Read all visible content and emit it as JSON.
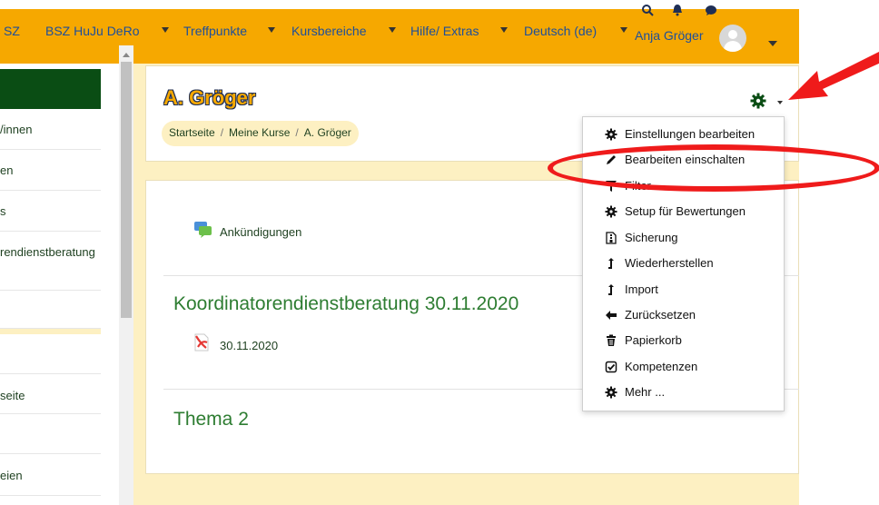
{
  "navbar": {
    "items": [
      {
        "label": "SZ",
        "caret": false
      },
      {
        "label": "BSZ HuJu DeRo",
        "caret": true
      },
      {
        "label": "Treffpunkte",
        "caret": true
      },
      {
        "label": "Kursbereiche",
        "caret": true
      },
      {
        "label": "Hilfe/ Extras",
        "caret": true
      },
      {
        "label": "Deutsch (de)",
        "caret": true
      }
    ],
    "icons": [
      "search-icon",
      "bell-icon",
      "chat-icon"
    ],
    "user_name": "Anja Gröger"
  },
  "drawer": {
    "items": [
      "/innen",
      "en",
      "s",
      "rendienstberatung",
      "",
      "",
      "seite",
      "",
      "eien"
    ]
  },
  "page": {
    "title": "A. Gröger",
    "breadcrumb": [
      "Startseite",
      "Meine Kurse",
      "A. Gröger"
    ]
  },
  "course": {
    "announcement": "Ankündigungen",
    "sections": [
      {
        "title": "Koordinatorendienstberatung 30.11.2020",
        "file": "30.11.2020"
      },
      {
        "title": "Thema 2"
      }
    ]
  },
  "menu": {
    "items": [
      {
        "label": "Einstellungen bearbeiten",
        "icon": "cog-icon"
      },
      {
        "label": "Bearbeiten einschalten",
        "icon": "pencil-icon"
      },
      {
        "label": "Filter",
        "icon": "filter-icon"
      },
      {
        "label": "Setup für Bewertungen",
        "icon": "cog-icon"
      },
      {
        "label": "Sicherung",
        "icon": "file-archive-icon"
      },
      {
        "label": "Wiederherstellen",
        "icon": "level-up-icon"
      },
      {
        "label": "Import",
        "icon": "level-up-icon"
      },
      {
        "label": "Zurücksetzen",
        "icon": "arrow-left-icon"
      },
      {
        "label": "Papierkorb",
        "icon": "trash-icon"
      },
      {
        "label": "Kompetenzen",
        "icon": "check-square-icon"
      },
      {
        "label": "Mehr ...",
        "icon": "cog-icon"
      }
    ]
  },
  "colors": {
    "navbar": "#f6a800",
    "page_bg": "#fdf0c2",
    "drawer_header": "#0a4d14",
    "section_title": "#2e7d32",
    "annotation": "#ef1b1b"
  }
}
